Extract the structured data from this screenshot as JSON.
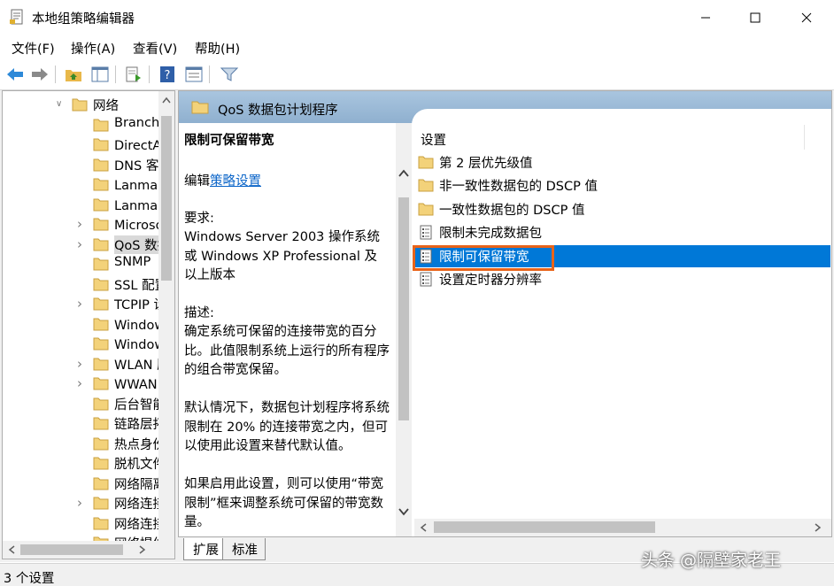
{
  "window": {
    "title": "本地组策略编辑器",
    "icon": "gpedit-document-icon",
    "controls": [
      "minimize-icon",
      "maximize-icon",
      "close-icon"
    ]
  },
  "menu": [
    {
      "label": "文件(F)"
    },
    {
      "label": "操作(A)"
    },
    {
      "label": "查看(V)"
    },
    {
      "label": "帮助(H)"
    }
  ],
  "toolbar": [
    "back-arrow-icon",
    "forward-arrow-icon",
    "up-folder-icon",
    "show-hide-tree-icon",
    "export-list-icon",
    "help-icon",
    "properties-icon",
    "filter-icon"
  ],
  "tree": {
    "items": [
      {
        "label": "网络",
        "expander": "expanded"
      },
      {
        "label": "BranchCache",
        "expander": ""
      },
      {
        "label": "DirectAccess 客户端体验设置",
        "expander": ""
      },
      {
        "label": "DNS 客户端",
        "expander": ""
      },
      {
        "label": "Lanman 服务器",
        "expander": ""
      },
      {
        "label": "Lanman 工作站",
        "expander": ""
      },
      {
        "label": "Microsoft 对等网络服务",
        "expander": "collapsed"
      },
      {
        "label": "QoS 数据包计划程序",
        "expander": "collapsed",
        "selected": true
      },
      {
        "label": "SNMP",
        "expander": ""
      },
      {
        "label": "SSL 配置设置",
        "expander": ""
      },
      {
        "label": "TCPIP 设置",
        "expander": "collapsed"
      },
      {
        "label": "Windows 连接管理器",
        "expander": ""
      },
      {
        "label": "Windows 连接现在",
        "expander": ""
      },
      {
        "label": "WLAN 服务",
        "expander": "collapsed"
      },
      {
        "label": "WWAN 服务",
        "expander": "collapsed"
      },
      {
        "label": "后台智能传输服务(BITS)",
        "expander": ""
      },
      {
        "label": "链路层拓扑发现",
        "expander": ""
      },
      {
        "label": "热点身份验证",
        "expander": ""
      },
      {
        "label": "脱机文件",
        "expander": ""
      },
      {
        "label": "网络隔离",
        "expander": ""
      },
      {
        "label": "网络连接",
        "expander": "collapsed"
      },
      {
        "label": "网络连接状态指示器",
        "expander": ""
      },
      {
        "label": "网络提供程序",
        "expander": ""
      }
    ]
  },
  "header": {
    "title": "QoS 数据包计划程序"
  },
  "description": {
    "title": "限制可保留带宽",
    "edit_prefix": "编辑",
    "edit_link": "策略设置",
    "requirements_label": "要求:",
    "requirements": "Windows Server 2003 操作系统或 Windows XP Professional 及以上版本",
    "desc_label": "描述:",
    "desc1": "确定系统可保留的连接带宽的百分比。此值限制系统上运行的所有程序的组合带宽保留。",
    "desc2": "默认情况下，数据包计划程序将系统限制在 20% 的连接带宽之内，但可以使用此设置来替代默认值。",
    "desc3": "如果启用此设置，则可以使用“带宽限制”框来调整系统可保留的带宽数量。"
  },
  "settings": {
    "column_header": "设置",
    "rows": [
      {
        "label": "第 2 层优先级值",
        "icon": "folder-icon"
      },
      {
        "label": "非一致性数据包的 DSCP 值",
        "icon": "folder-icon"
      },
      {
        "label": "一致性数据包的 DSCP 值",
        "icon": "folder-icon"
      },
      {
        "label": "限制未完成数据包",
        "icon": "policy-setting-icon"
      },
      {
        "label": "限制可保留带宽",
        "icon": "policy-setting-icon",
        "selected": true
      },
      {
        "label": "设置定时器分辨率",
        "icon": "policy-setting-icon"
      }
    ]
  },
  "tabs": [
    {
      "label": "扩展",
      "active": true
    },
    {
      "label": "标准",
      "active": false
    }
  ],
  "status": {
    "text": "3 个设置"
  },
  "watermark": {
    "text": "头条 @隔壁家老王"
  },
  "colors": {
    "selection": "#0078d7",
    "highlight_outline": "#e8641a",
    "header_band": "#9dbcd9",
    "link": "#0a64c8"
  }
}
